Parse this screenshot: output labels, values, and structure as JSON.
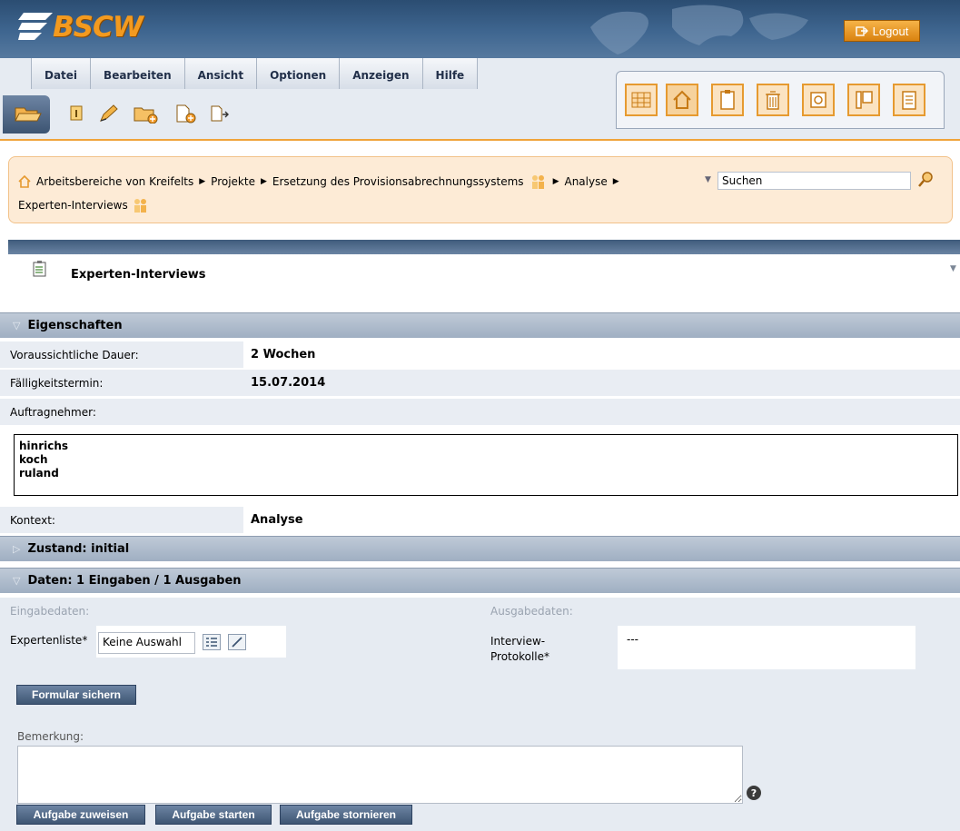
{
  "header": {
    "logo_text": "BSCW",
    "logout_label": "Logout"
  },
  "menu": [
    "Datei",
    "Bearbeiten",
    "Ansicht",
    "Optionen",
    "Anzeigen",
    "Hilfe"
  ],
  "breadcrumb": {
    "items": [
      "Arbeitsbereiche von Kreifelts",
      "Projekte",
      "Ersetzung des Provisionsabrechnungssystems",
      "Analyse"
    ],
    "current": "Experten-Interviews"
  },
  "search": {
    "value": "Suchen"
  },
  "title": "Experten-Interviews",
  "sections": {
    "properties": {
      "title": "Eigenschaften",
      "duration_label": "Voraussichtliche Dauer:",
      "duration_value": "2 Wochen",
      "due_label": "Fälligkeitstermin:",
      "due_value": "15.07.2014",
      "assignee_label": "Auftragnehmer:",
      "assignees": [
        "hinrichs",
        "koch",
        "ruland"
      ],
      "context_label": "Kontext:",
      "context_value": "Analyse"
    },
    "state": {
      "title": "Zustand: initial"
    },
    "data": {
      "title": "Daten: 1 Eingaben / 1 Ausgaben",
      "input_heading": "Eingabedaten:",
      "output_heading": "Ausgabedaten:",
      "input_field_label": "Expertenliste*",
      "input_field_value": "Keine Auswahl",
      "output_field_label_line1": "Interview-",
      "output_field_label_line2": "Protokolle*",
      "output_field_value": "---"
    }
  },
  "buttons": {
    "save_form": "Formular sichern",
    "assign": "Aufgabe zuweisen",
    "start": "Aufgabe starten",
    "cancel": "Aufgabe stornieren"
  },
  "remark_label": "Bemerkung:",
  "help_glyph": "?",
  "colors": {
    "accent_orange": "#f39a1f",
    "header_blue": "#3f6690",
    "section_grey": "#b0bdcc"
  }
}
